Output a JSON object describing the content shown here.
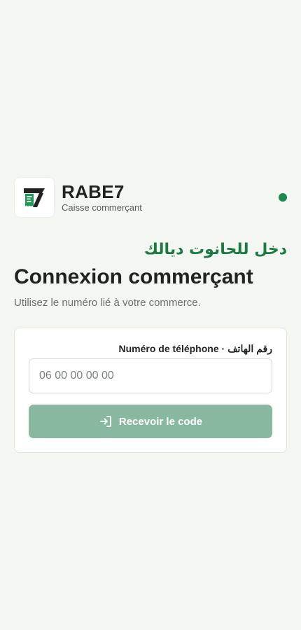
{
  "brand": {
    "name": "RABE7",
    "subtitle": "Caisse commerçant",
    "logo_icon": "receipt-seven-logo",
    "status_color": "#1a8a4c"
  },
  "login": {
    "arabic_title": "دخل للحانوت ديالك",
    "title": "Connexion commerçant",
    "description": "Utilisez le numéro lié à votre commerce."
  },
  "form": {
    "phone_label": "Numéro de téléphone · رقم الهاتف",
    "phone_value": "",
    "phone_placeholder": "06 00 00 00 00",
    "submit_label": "Recevoir le code",
    "submit_icon": "login-arrow-icon",
    "submit_color": "#88b8a0"
  }
}
